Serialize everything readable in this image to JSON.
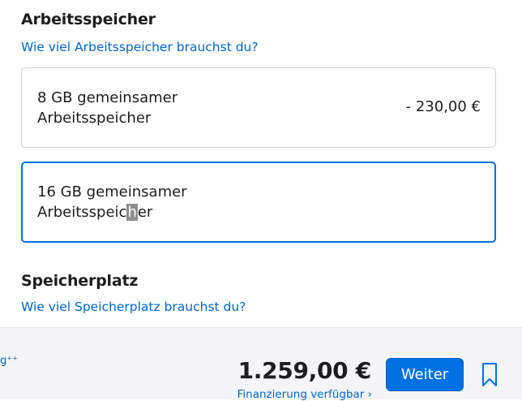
{
  "memory": {
    "title": "Arbeitsspeicher",
    "help_link": "Wie viel Arbeitsspeicher brauchst du?",
    "options": [
      {
        "line1": "8 GB gemeinsamer",
        "line2": "Arbeitsspeicher",
        "price": "- 230,00 €"
      },
      {
        "line1": "16 GB gemeinsamer",
        "line2_before": "Arbeitsspeic",
        "line2_highlight": "h",
        "line2_after": "er",
        "price": ""
      }
    ]
  },
  "storage": {
    "title": "Speicherplatz",
    "help_link": "Wie viel Speicherplatz brauchst du?"
  },
  "footer": {
    "left_fragment": "g⁺⁺",
    "total": "1.259,00 €",
    "financing": "Finanzierung verfügbar ›",
    "continue_label": "Weiter",
    "bookmark_icon": "bookmark-icon",
    "accent_color": "#0071e3"
  }
}
